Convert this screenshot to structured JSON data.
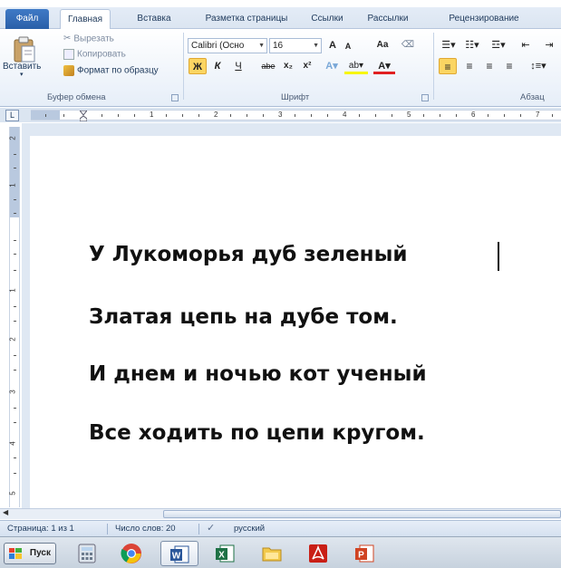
{
  "ribbon_tabs": [
    "Файл",
    "Главная",
    "Вставка",
    "Разметка страницы",
    "Ссылки",
    "Рассылки",
    "Рецензирование"
  ],
  "active_tab": "Главная",
  "clipboard": {
    "paste": "Вставить",
    "cut": "Вырезать",
    "copy": "Копировать",
    "format_painter": "Формат по образцу",
    "group_label": "Буфер обмена"
  },
  "font": {
    "font_name": "Calibri (Осно",
    "font_size": "16",
    "group_label": "Шрифт",
    "bold": "Ж",
    "italic": "К",
    "underline": "Ч",
    "strike": "abe",
    "subscript": "x₂",
    "superscript": "x²",
    "grow": "A",
    "shrink": "A",
    "case": "Aa"
  },
  "paragraph": {
    "group_label": "Абзац"
  },
  "ruler": {
    "numbers": [
      "1",
      "2",
      "3",
      "4",
      "5",
      "6",
      "7"
    ],
    "vertical_numbers": [
      "2",
      "1",
      "1",
      "2",
      "3",
      "4",
      "5"
    ]
  },
  "document": {
    "lines": [
      "У Лукоморья дуб зеленый",
      "Златая цепь на дубе том.",
      "И днем и ночью кот ученый",
      "Все ходить по цепи кругом."
    ]
  },
  "status_bar": {
    "page": "Страница: 1 из 1",
    "words": "Число слов: 20",
    "language": "русский"
  },
  "taskbar": {
    "start": "Пуск",
    "apps": [
      "calculator-icon",
      "chrome-icon",
      "word-icon",
      "excel-icon",
      "explorer-icon",
      "pdf-reader-icon",
      "powerpoint-icon"
    ]
  },
  "colors": {
    "file_tab": "#2a5fa8",
    "ribbon": "#e6eef8",
    "bold_active": "#fbd562"
  }
}
